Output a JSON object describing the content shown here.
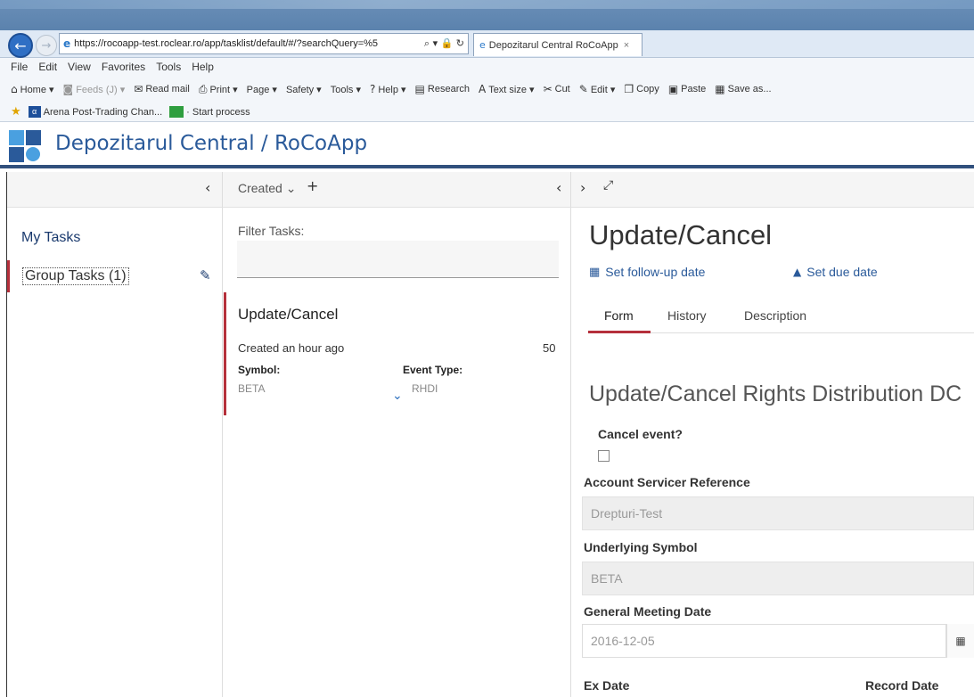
{
  "browser": {
    "url": "https://rocoapp-test.roclear.ro/app/tasklist/default/#/?searchQuery=%5",
    "address_controls": "⌕ ▾ 🔒 ↻",
    "tab_title": "Depozitarul Central RoCoApp",
    "tab_close": "×",
    "menu": [
      "File",
      "Edit",
      "View",
      "Favorites",
      "Tools",
      "Help"
    ],
    "commands": [
      {
        "icon": "home-icon",
        "glyph": "⌂",
        "label": "Home ▾"
      },
      {
        "icon": "feeds-icon",
        "glyph": "◙",
        "label": "Feeds (J) ▾",
        "dim": true
      },
      {
        "icon": "mail-icon",
        "glyph": "✉",
        "label": "Read mail"
      },
      {
        "icon": "print-icon",
        "glyph": "⎙",
        "label": "Print ▾"
      },
      {
        "icon": "page-icon",
        "glyph": "",
        "label": "Page ▾"
      },
      {
        "icon": "safety-icon",
        "glyph": "",
        "label": "Safety ▾"
      },
      {
        "icon": "tools-icon",
        "glyph": "",
        "label": "Tools ▾"
      },
      {
        "icon": "help-icon",
        "glyph": "?",
        "label": "Help ▾"
      },
      {
        "icon": "research-icon",
        "glyph": "▤",
        "label": "Research"
      },
      {
        "icon": "textsize-icon",
        "glyph": "A",
        "label": "Text size ▾"
      },
      {
        "icon": "cut-icon",
        "glyph": "✂",
        "label": "Cut"
      },
      {
        "icon": "edit-icon",
        "glyph": "✎",
        "label": "Edit ▾"
      },
      {
        "icon": "copy-icon",
        "glyph": "❐",
        "label": "Copy"
      },
      {
        "icon": "paste-icon",
        "glyph": "▣",
        "label": "Paste"
      },
      {
        "icon": "saveas-icon",
        "glyph": "▦",
        "label": "Save as..."
      }
    ],
    "favorites": [
      "Arena Post-Trading Chan...",
      "· Start process"
    ],
    "fav_icon_text": "α"
  },
  "app": {
    "title": "Depozitarul Central / RoCoApp"
  },
  "toolbar": {
    "left_collapse": "‹",
    "sort_label": "Created",
    "sort_caret": "⌄",
    "add": "+",
    "mid_collapse": "‹",
    "right_expand": "›",
    "maximize": "⤢"
  },
  "sidebar": {
    "my_tasks": "My Tasks",
    "group_tasks": "Group Tasks (1)",
    "edit_glyph": "✎"
  },
  "tasklist": {
    "filter_label": "Filter Tasks:",
    "filter_value": "",
    "task": {
      "title": "Update/Cancel",
      "created": "Created an hour ago",
      "priority": "50",
      "symbol_label": "Symbol:",
      "symbol_value": "BETA",
      "event_type_label": "Event Type:",
      "event_type_value": "RHDI",
      "expand_glyph": "⌄"
    }
  },
  "detail": {
    "title": "Update/Cancel",
    "follow_up": "Set follow-up date",
    "follow_up_glyph": "▦",
    "due_date": "Set due date",
    "due_date_glyph": "🔔",
    "tabs": [
      "Form",
      "History",
      "Description"
    ],
    "active_tab": "Form",
    "form": {
      "heading": "Update/Cancel Rights Distribution DC",
      "cancel_event_label": "Cancel event?",
      "cancel_event_checked": false,
      "account_ref_label": "Account Servicer Reference",
      "account_ref_value": "Drepturi-Test",
      "underlying_symbol_label": "Underlying Symbol",
      "underlying_symbol_value": "BETA",
      "gm_date_label": "General Meeting Date",
      "gm_date_value": "2016-12-05",
      "calendar_glyph": "▦",
      "ex_date_label": "Ex Date",
      "record_date_label": "Record Date"
    }
  },
  "colors": {
    "accent_red": "#b5303b",
    "brand_blue": "#2a5a9a",
    "header_rule": "#31507d"
  }
}
